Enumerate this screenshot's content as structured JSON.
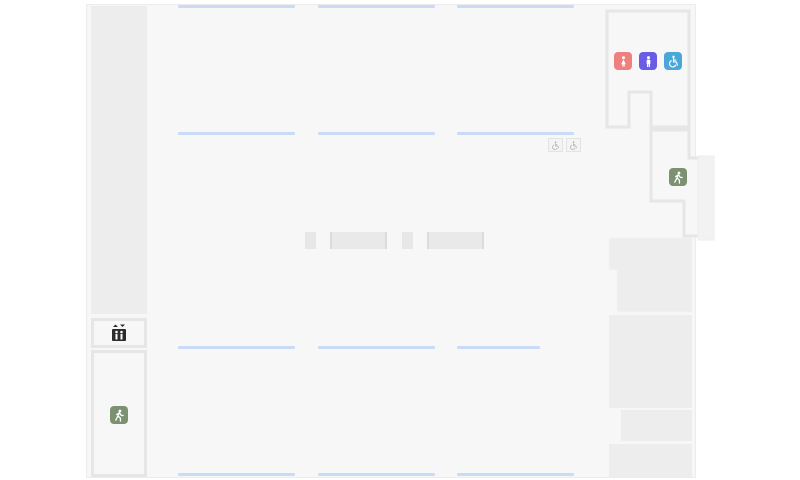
{
  "map": {
    "colors": {
      "background": "#f7f7f7",
      "block": "#ededed",
      "wall": "#e6e6e6",
      "aisle": "#c9dbf7",
      "exit": "#7b9171",
      "women": "#f08080",
      "men": "#6b5ce6",
      "accessible": "#4aa8d8"
    },
    "icons": [
      "women-restroom-icon",
      "men-restroom-icon",
      "accessible-restroom-icon",
      "emergency-exit-icon",
      "elevator-icon",
      "wheelchair-parking-icon"
    ]
  }
}
